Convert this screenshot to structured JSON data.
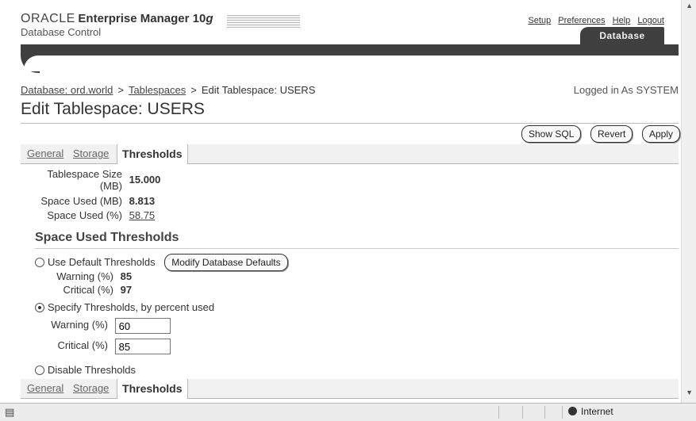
{
  "header": {
    "brand": "ORACLE",
    "product": "Enterprise Manager",
    "version": "10",
    "version_suffix": "g",
    "subtitle": "Database Control",
    "global_links": [
      "Setup",
      "Preferences",
      "Help",
      "Logout"
    ],
    "active_tab": "Database"
  },
  "breadcrumb": {
    "items": [
      "Database: ord.world",
      "Tablespaces"
    ],
    "current": "Edit Tablespace: USERS",
    "separator": ">"
  },
  "logged_in": "Logged in As SYSTEM",
  "page_title": "Edit Tablespace: USERS",
  "buttons": {
    "show_sql": "Show SQL",
    "revert": "Revert",
    "apply": "Apply"
  },
  "tabs": [
    {
      "label": "General",
      "active": false
    },
    {
      "label": "Storage",
      "active": false
    },
    {
      "label": "Thresholds",
      "active": true
    }
  ],
  "info": {
    "size_label_line1": "Tablespace Size",
    "size_label_line2": "(MB)",
    "size_value": "15.000",
    "used_mb_label": "Space Used (MB)",
    "used_mb_value": "8.813",
    "used_pct_label": "Space Used (%)",
    "used_pct_value": "58.75"
  },
  "thresholds": {
    "section_title": "Space Used Thresholds",
    "use_default_label": "Use Default Thresholds",
    "modify_defaults_button": "Modify Database Defaults",
    "default_warning_label": "Warning (%)",
    "default_warning_value": "85",
    "default_critical_label": "Critical (%)",
    "default_critical_value": "97",
    "specify_label": "Specify Thresholds, by percent used",
    "warning_label": "Warning (%)",
    "warning_value": "60",
    "critical_label": "Critical (%)",
    "critical_value": "85",
    "disable_label": "Disable Thresholds",
    "selected_option": "specify"
  },
  "status_bar": {
    "zone": "Internet"
  },
  "colors": {
    "header_bar": "#3f3f3f",
    "tab_bar": "#f1f1f1"
  }
}
